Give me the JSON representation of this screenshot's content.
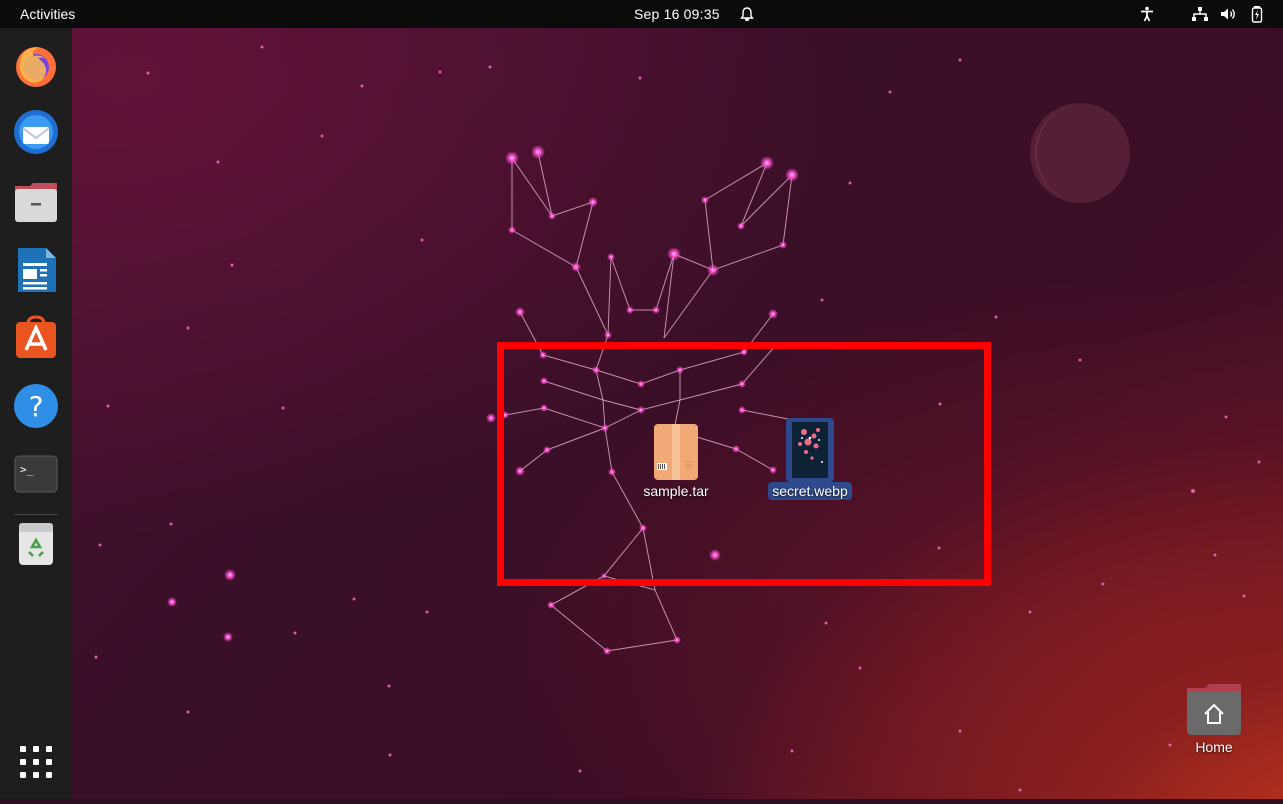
{
  "topbar": {
    "activities_label": "Activities",
    "clock": "Sep 16  09:35",
    "icons": [
      "notification-bell-icon",
      "accessibility-icon",
      "network-icon",
      "volume-icon",
      "battery-icon"
    ]
  },
  "dock": {
    "apps": [
      {
        "name": "Firefox",
        "icon": "firefox-icon"
      },
      {
        "name": "Thunderbird",
        "icon": "thunderbird-icon"
      },
      {
        "name": "Files",
        "icon": "files-icon"
      },
      {
        "name": "LibreOffice Writer",
        "icon": "writer-icon"
      },
      {
        "name": "Ubuntu Software",
        "icon": "software-icon"
      },
      {
        "name": "Help",
        "icon": "help-icon"
      },
      {
        "name": "Terminal",
        "icon": "terminal-icon"
      },
      {
        "name": "Trash",
        "icon": "trash-icon"
      }
    ],
    "show_apps_icon": "grid-icon"
  },
  "desktop": {
    "files": [
      {
        "label": "sample.tar",
        "icon": "archive-icon",
        "selected": false
      },
      {
        "label": "secret.webp",
        "icon": "image-icon",
        "selected": true
      }
    ],
    "home": {
      "label": "Home",
      "icon": "home-folder-icon"
    }
  },
  "colors": {
    "topbar": "#0b0b0b",
    "dock": "#1e1e1e",
    "highlight": "#ff0000",
    "selection": "#2f4a8c"
  }
}
